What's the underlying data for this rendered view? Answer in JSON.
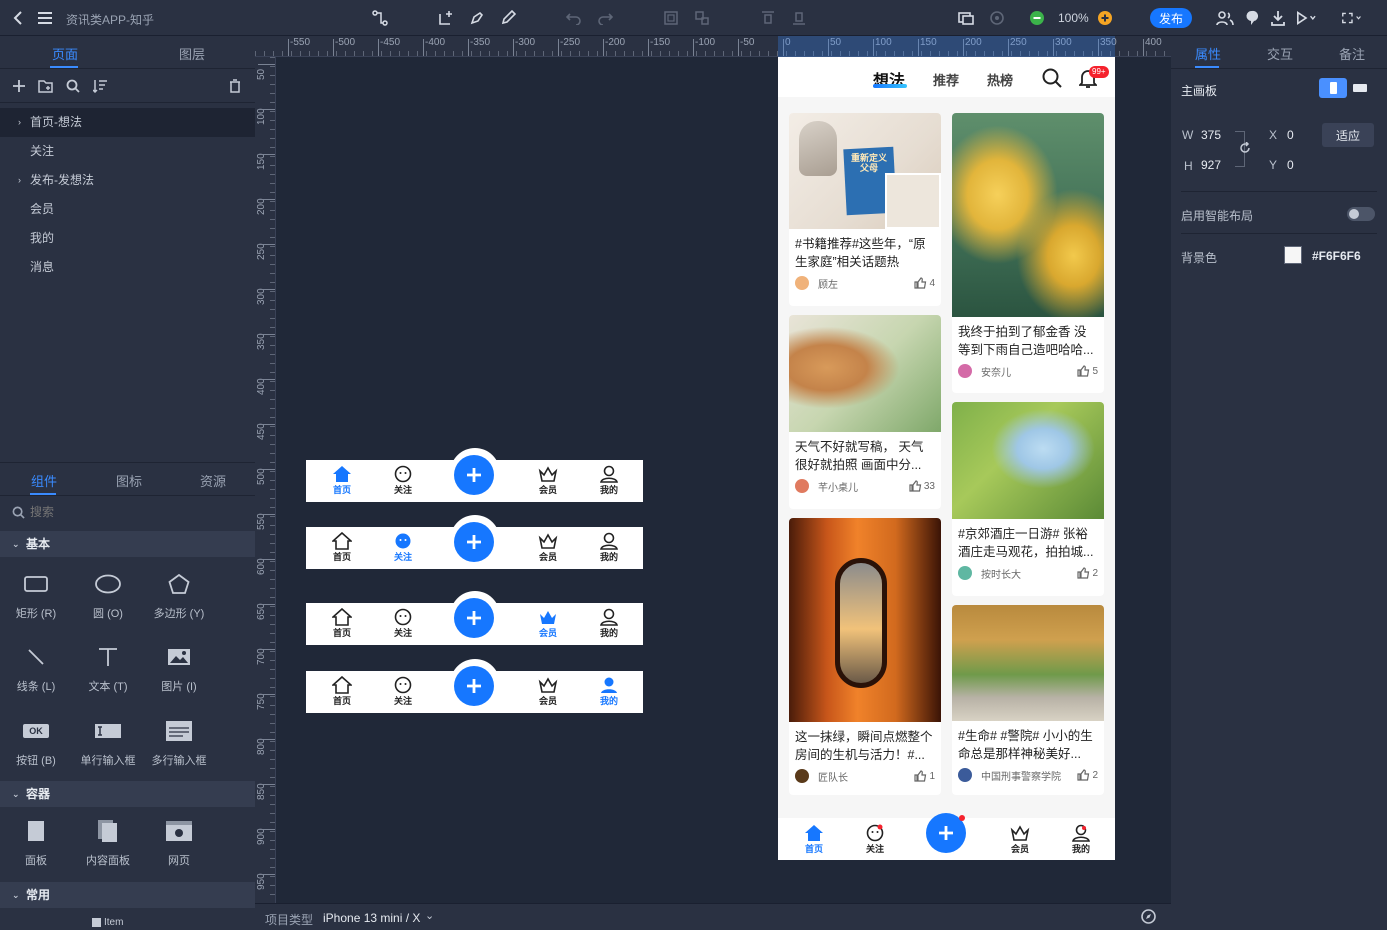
{
  "topbar": {
    "title": "资讯类APP-知乎",
    "zoom": "100%",
    "publish": "发布"
  },
  "left": {
    "tabs": [
      "页面",
      "图层"
    ],
    "pages": [
      {
        "label": "首页-想法",
        "expandable": true,
        "selected": true
      },
      {
        "label": "关注",
        "expandable": false
      },
      {
        "label": "发布-发想法",
        "expandable": true
      },
      {
        "label": "会员",
        "expandable": false
      },
      {
        "label": "我的",
        "expandable": false
      },
      {
        "label": "消息",
        "expandable": false
      }
    ],
    "lib_tabs": [
      "组件",
      "图标",
      "资源"
    ],
    "search_placeholder": "搜索",
    "sections": {
      "basic": "基本",
      "container": "容器",
      "common": "常用"
    },
    "basic_components": [
      "矩形 (R)",
      "圆 (O)",
      "多边形 (Y)",
      "线条 (L)",
      "文本 (T)",
      "图片 (I)",
      "按钮 (B)",
      "单行输入框",
      "多行输入框"
    ],
    "container_components": [
      "面板",
      "内容面板",
      "网页"
    ],
    "common_partial": "Item"
  },
  "ruler": {
    "top": [
      "-550",
      "-500",
      "-450",
      "-400",
      "-350",
      "-300",
      "-250",
      "-200",
      "-150",
      "-100",
      "-50",
      "0",
      "50",
      "100",
      "150",
      "200",
      "250",
      "300",
      "350",
      "400"
    ],
    "left": [
      "50",
      "100",
      "150",
      "200",
      "250",
      "300",
      "350",
      "400",
      "450",
      "500",
      "550",
      "600",
      "650",
      "700",
      "750",
      "800",
      "850",
      "900",
      "950"
    ]
  },
  "bottombar": {
    "label": "项目类型",
    "device": "iPhone 13 mini / X"
  },
  "phone": {
    "tabs": [
      "想法",
      "推荐",
      "热榜"
    ],
    "badge": "99+",
    "cards": [
      {
        "text": "#书籍推荐#这些年，“原生家庭”相关话题热",
        "user": "顾左",
        "likes": "4",
        "book_text": "重新定义父母"
      },
      {
        "text": "我终于拍到了郁金香 没等到下雨自己造吧哈哈...",
        "user": "安奈儿",
        "likes": "5"
      },
      {
        "text": "天气不好就写稿， 天气很好就拍照 画面中分...",
        "user": "芊小桌儿",
        "likes": "33"
      },
      {
        "text": "#京郊酒庄一日游# 张裕酒庄走马观花，拍拍城...",
        "user": "按时长大",
        "likes": "2"
      },
      {
        "text": "这一抹绿，瞬间点燃整个房间的生机与活力！#...",
        "user": "匠队长",
        "likes": "1"
      },
      {
        "text": "#生命# #警院#  小小的生命总是那样神秘美好...",
        "user": "中国刑事警察学院",
        "likes": "2"
      }
    ],
    "nav": [
      "首页",
      "关注",
      "会员",
      "我的"
    ]
  },
  "variants": {
    "nav": [
      "首页",
      "关注",
      "会员",
      "我的"
    ]
  },
  "right": {
    "tabs": [
      "属性",
      "交互",
      "备注"
    ],
    "artboard": "主画板",
    "w_label": "W",
    "w": "375",
    "h_label": "H",
    "h": "927",
    "x_label": "X",
    "x": "0",
    "y_label": "Y",
    "y": "0",
    "fit": "适应",
    "smart_layout": "启用智能布局",
    "bg_label": "背景色",
    "bg_value": "#F6F6F6"
  },
  "colors": {
    "accent": "#1677ff",
    "panel": "#2a3142",
    "canvas": "#202838"
  }
}
